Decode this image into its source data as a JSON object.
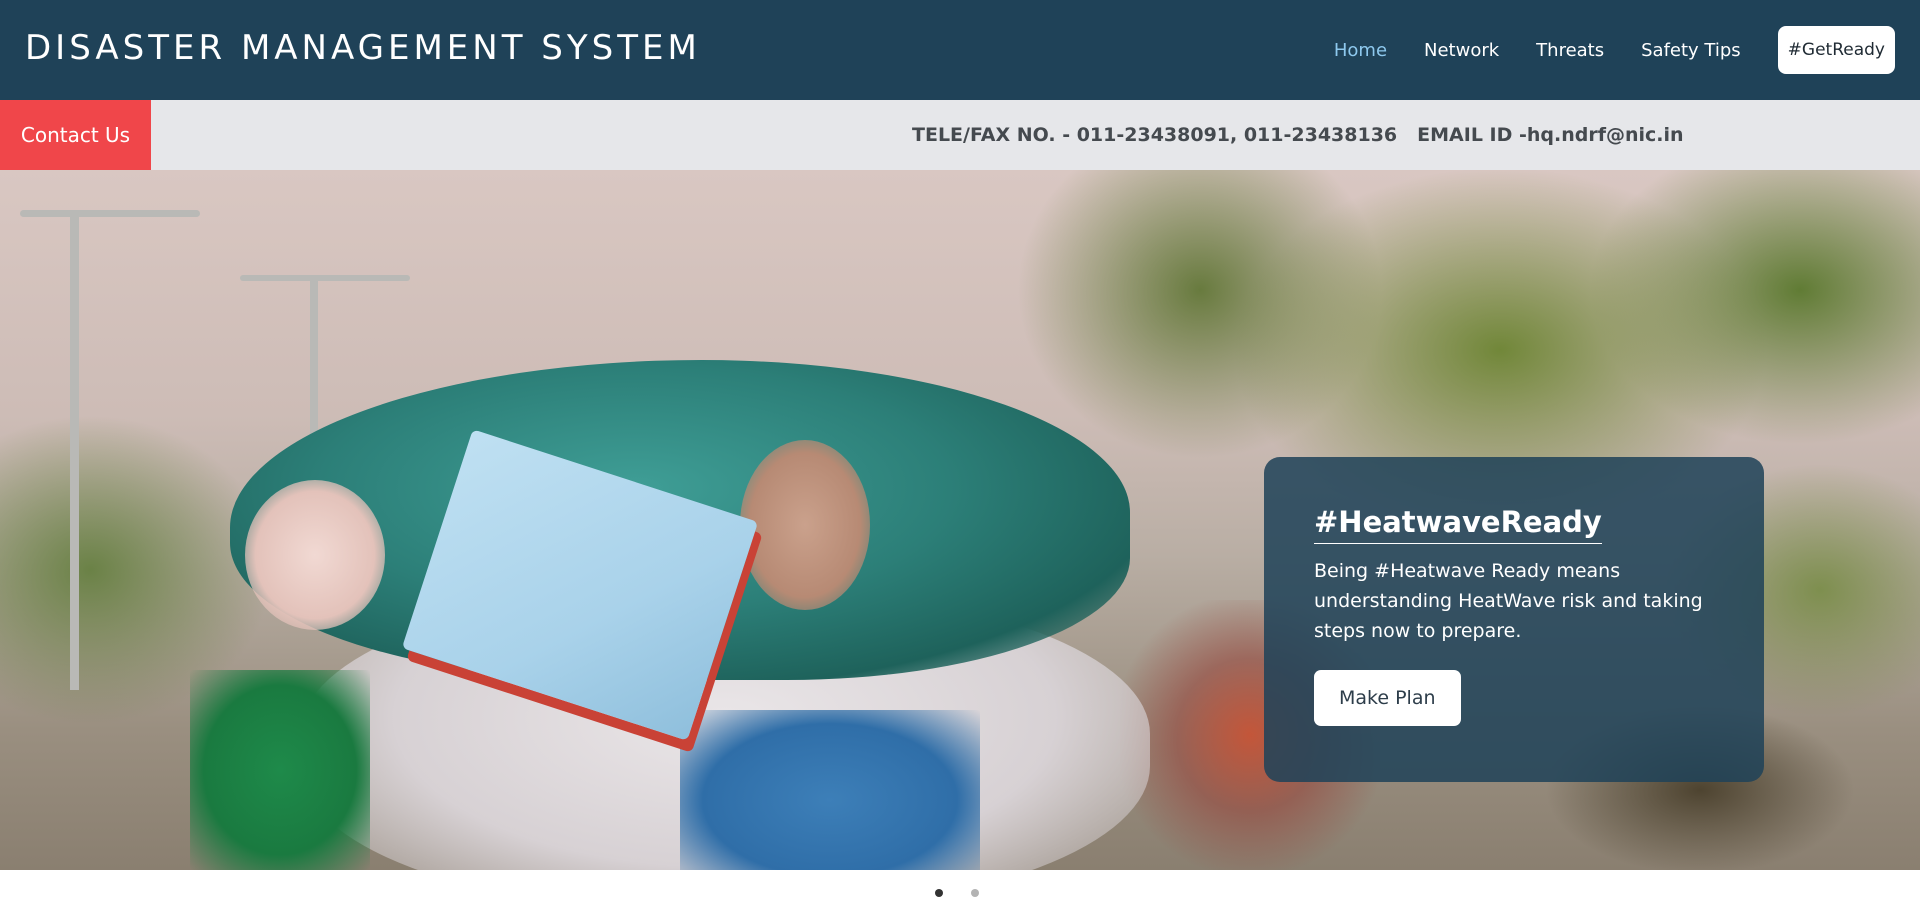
{
  "header": {
    "title": "DISASTER MANAGEMENT SYSTEM",
    "nav": [
      {
        "label": "Home",
        "active": true
      },
      {
        "label": "Network",
        "active": false
      },
      {
        "label": "Threats",
        "active": false
      },
      {
        "label": "Safety Tips",
        "active": false
      }
    ],
    "cta_label": "#GetReady"
  },
  "infobar": {
    "contact_label": "Contact Us",
    "phone": "TELE/FAX NO. - 011-23438091, 011-23438136",
    "email": "EMAIL ID -hq.ndrf@nic.in"
  },
  "hero": {
    "title": "#HeatwaveReady",
    "text": "Being #Heatwave Ready means understanding HeatWave risk and taking steps now to prepare.",
    "button_label": "Make Plan"
  },
  "carousel": {
    "total_slides": 2,
    "active_slide": 1
  },
  "colors": {
    "header_bg": "#1f4258",
    "nav_active": "#8ec9ee",
    "contact_bg": "#f0464a",
    "infobar_bg": "#e6e7ea"
  }
}
